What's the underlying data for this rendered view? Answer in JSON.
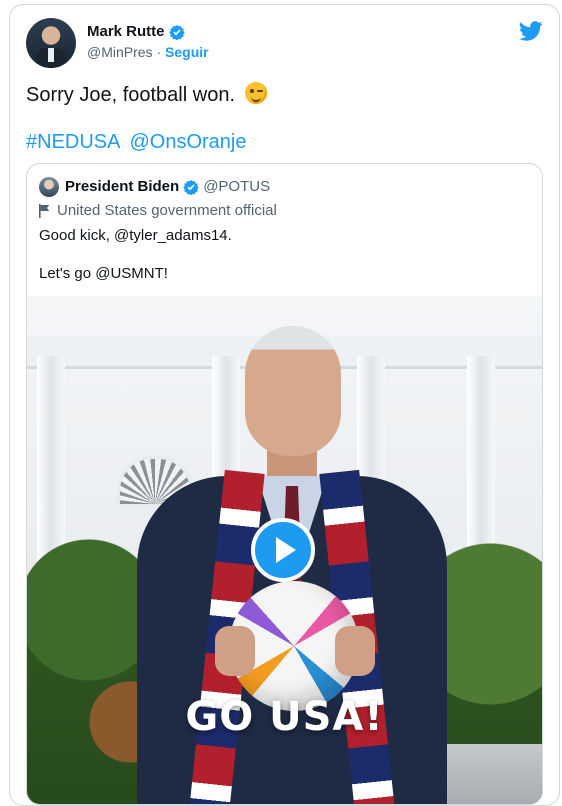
{
  "author": {
    "name": "Mark Rutte",
    "handle": "@MinPres",
    "separator": "·",
    "follow_label": "Seguir"
  },
  "tweet": {
    "text": "Sorry Joe, football won.",
    "emoji_icon": "winking-face-emoji",
    "hashtags": [
      "#NEDUSA",
      "@OnsOranje"
    ]
  },
  "quoted": {
    "name": "President Biden",
    "handle": "@POTUS",
    "label": "United States government official",
    "text_line1": "Good kick, @tyler_adams14.",
    "text_line2": "Let's go @USMNT!",
    "media": {
      "overlay_text": "GO USA!",
      "play_icon": "play-icon"
    }
  },
  "colors": {
    "accent": "#1d9bf0",
    "text": "#0f1419",
    "muted": "#536471",
    "border": "#cfd9de"
  }
}
